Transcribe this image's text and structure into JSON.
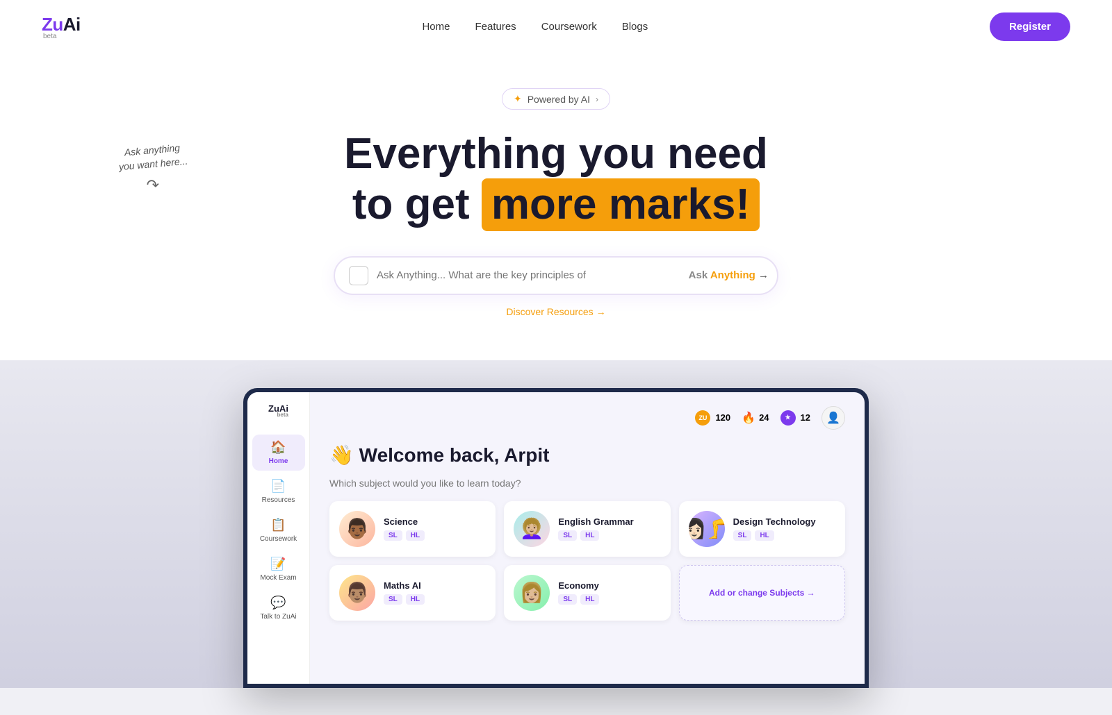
{
  "navbar": {
    "logo": "ZuAi",
    "beta": "beta",
    "nav_items": [
      "Home",
      "Features",
      "Coursework",
      "Blogs"
    ],
    "register_label": "Register"
  },
  "hero": {
    "powered_label": "Powered by AI",
    "title_line1": "Everything you need",
    "title_line2_prefix": "to get ",
    "title_line2_highlight": "more marks!",
    "annotation": "Ask anything\nyou want here...",
    "search_placeholder": "Ask Anything... What are the key principles of",
    "ask_label": "Ask",
    "anything_label": "Anything",
    "arrow": "→",
    "discover_label": "Discover Resources →"
  },
  "app": {
    "logo": "ZuAi",
    "beta": "beta",
    "sidebar_items": [
      {
        "id": "home",
        "label": "Home",
        "icon": "🏠",
        "active": true
      },
      {
        "id": "resources",
        "label": "Resources",
        "icon": "📄",
        "active": false
      },
      {
        "id": "coursework",
        "label": "Coursework",
        "icon": "📋",
        "active": false
      },
      {
        "id": "mock-exam",
        "label": "Mock Exam",
        "icon": "📝",
        "active": false
      },
      {
        "id": "talk",
        "label": "Talk to ZuAi",
        "icon": "💬",
        "active": false
      }
    ],
    "stats": [
      {
        "id": "zu",
        "icon": "ZU",
        "value": "120"
      },
      {
        "id": "fire",
        "icon": "🔥",
        "value": "24"
      },
      {
        "id": "star",
        "icon": "★",
        "value": "12"
      }
    ],
    "welcome": "👋 Welcome back, Arpit",
    "subtitle": "Which subject would you like to learn today?",
    "subjects": [
      {
        "id": "science",
        "name": "Science",
        "emoji": "👨🏾",
        "tags": [
          "SL",
          "HL"
        ],
        "avatarClass": ""
      },
      {
        "id": "english-grammar",
        "name": "English Grammar",
        "emoji": "👩🏼‍🦱",
        "tags": [
          "SL",
          "HL"
        ],
        "avatarClass": "blue"
      },
      {
        "id": "design-technology",
        "name": "Design Technology",
        "emoji": "👩🏻‍🦵",
        "tags": [
          "SL",
          "HL"
        ],
        "avatarClass": "purple"
      },
      {
        "id": "maths-ai",
        "name": "Maths AI",
        "emoji": "👨🏽",
        "tags": [
          "SL",
          "HL"
        ],
        "avatarClass": "brown"
      },
      {
        "id": "economy",
        "name": "Economy",
        "emoji": "👩🏼",
        "tags": [
          "SL",
          "HL"
        ],
        "avatarClass": "green"
      }
    ],
    "add_subject_label": "Add or change Subjects →"
  }
}
